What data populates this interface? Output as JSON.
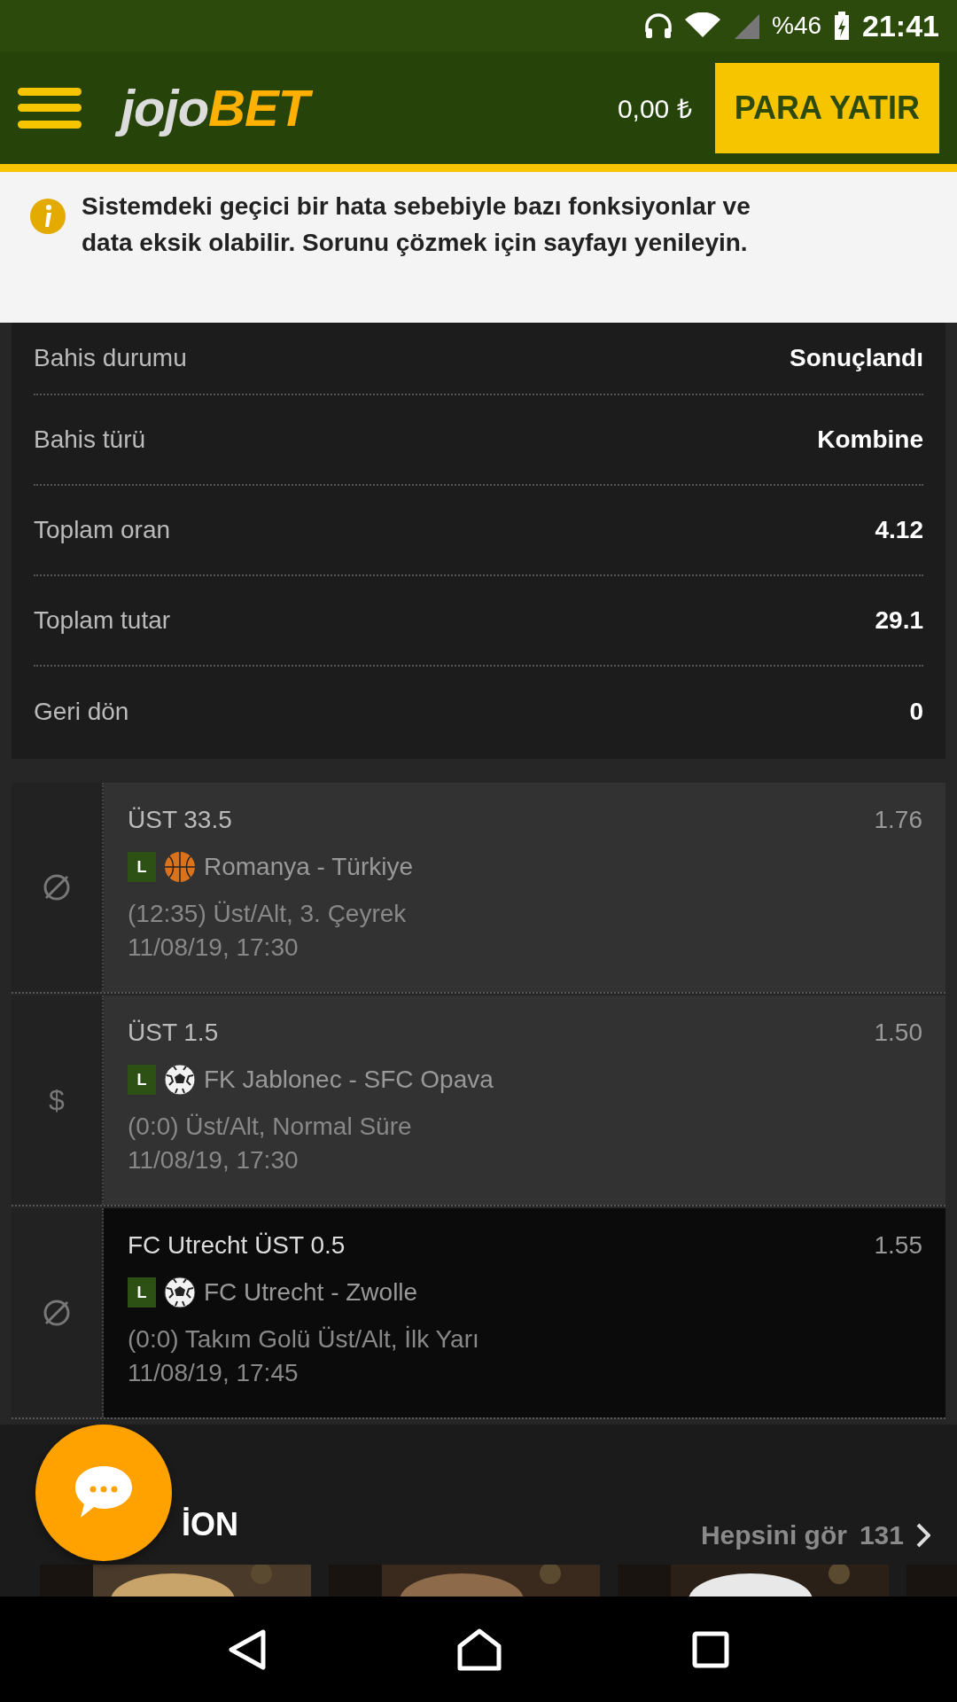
{
  "status_bar": {
    "battery": "%46",
    "time": "21:41"
  },
  "header": {
    "logo_left": "jojo",
    "logo_right": "BET",
    "balance": "0,00 ₺",
    "deposit_button": "PARA YATIR"
  },
  "notice": {
    "text": "Sistemdeki geçici bir hata sebebiyle bazı fonksiyonlar ve data eksik olabilir. Sorunu çözmek için sayfayı yenileyin."
  },
  "bet_details": [
    {
      "label": "Bahis durumu",
      "value": "Sonuçlandı"
    },
    {
      "label": "Bahis türü",
      "value": "Kombine"
    },
    {
      "label": "Toplam oran",
      "value": "4.12"
    },
    {
      "label": "Toplam tutar",
      "value": "29.1"
    },
    {
      "label": "Geri dön",
      "value": "0"
    }
  ],
  "selections": [
    {
      "kind": "void",
      "selected": false,
      "market": "ÜST 33.5",
      "odds": "1.76",
      "live_badge": "L",
      "sport_icon": {
        "kind": "basketball"
      },
      "match": "Romanya - Türkiye",
      "detail": "(12:35) Üst/Alt, 3. Çeyrek",
      "date": "11/08/19, 17:30"
    },
    {
      "kind": "symbol",
      "symbol": "$",
      "selected": false,
      "market": "ÜST 1.5",
      "odds": "1.50",
      "live_badge": "L",
      "sport_icon": {
        "kind": "soccer"
      },
      "match": "FK Jablonec - SFC Opava",
      "detail": "(0:0) Üst/Alt, Normal Süre",
      "date": "11/08/19, 17:30"
    },
    {
      "kind": "void",
      "selected": true,
      "market": "FC Utrecht ÜST 0.5",
      "odds": "1.55",
      "live_badge": "L",
      "sport_icon": {
        "kind": "soccer"
      },
      "match": "FC Utrecht - Zwolle",
      "detail": "(0:0) Takım Golü Üst/Alt, İlk Yarı",
      "date": "11/08/19, 17:45"
    }
  ],
  "section": {
    "title": "İON",
    "see_all": "Hepsini gör",
    "count": "131"
  }
}
